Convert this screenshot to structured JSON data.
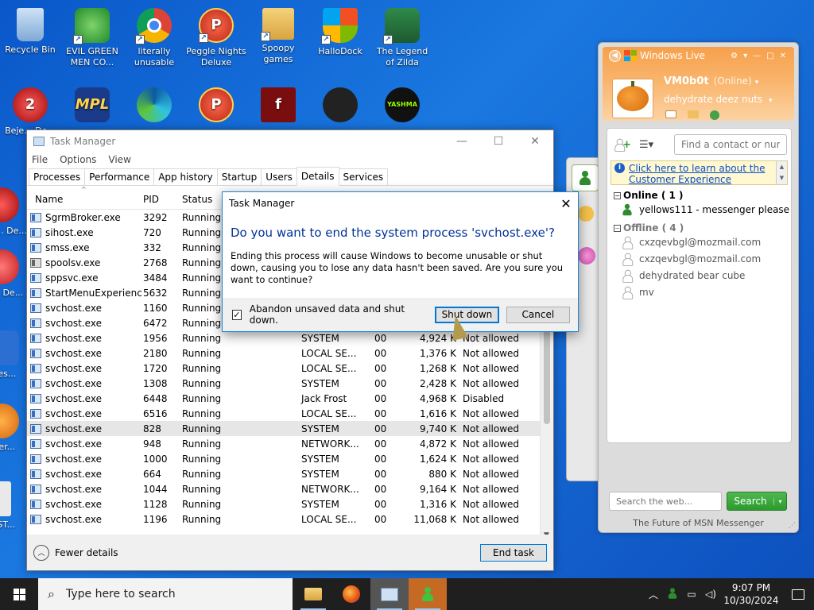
{
  "desktop": {
    "icons": [
      {
        "label": "Recycle Bin"
      },
      {
        "label": "EVIL GREEN MEN CO..."
      },
      {
        "label": "literally unusable"
      },
      {
        "label": "Peggle Nights Deluxe"
      },
      {
        "label": "Spoopy games"
      },
      {
        "label": "HalloDock"
      },
      {
        "label": "The Legend of Zilda"
      },
      {
        "label": "Beje... De..."
      },
      {
        "label": "Beje... De..."
      },
      {
        "label": "Ch... De..."
      },
      {
        "label": "does..."
      },
      {
        "label": "Ever..."
      },
      {
        "label": "INST..."
      }
    ]
  },
  "taskmgr": {
    "title": "Task Manager",
    "menu": [
      "File",
      "Options",
      "View"
    ],
    "tabs": [
      "Processes",
      "Performance",
      "App history",
      "Startup",
      "Users",
      "Details",
      "Services"
    ],
    "active_tab": "Details",
    "columns": {
      "name": "Name",
      "pid": "PID",
      "status": "Status"
    },
    "rows": [
      {
        "name": "SgrmBroker.exe",
        "pid": "3292",
        "status": "Running",
        "user": "",
        "cpu": "",
        "mem": "",
        "uac": ""
      },
      {
        "name": "sihost.exe",
        "pid": "720",
        "status": "Running",
        "user": "",
        "cpu": "",
        "mem": "",
        "uac": ""
      },
      {
        "name": "smss.exe",
        "pid": "332",
        "status": "Running",
        "user": "",
        "cpu": "",
        "mem": "",
        "uac": ""
      },
      {
        "name": "spoolsv.exe",
        "pid": "2768",
        "status": "Running",
        "user": "",
        "cpu": "",
        "mem": "",
        "uac": "",
        "icon": "printer"
      },
      {
        "name": "sppsvc.exe",
        "pid": "3484",
        "status": "Running",
        "user": "",
        "cpu": "",
        "mem": "",
        "uac": ""
      },
      {
        "name": "StartMenuExperienc...",
        "pid": "5632",
        "status": "Running",
        "user": "",
        "cpu": "",
        "mem": "",
        "uac": ""
      },
      {
        "name": "svchost.exe",
        "pid": "1160",
        "status": "Running",
        "user": "",
        "cpu": "",
        "mem": "",
        "uac": ""
      },
      {
        "name": "svchost.exe",
        "pid": "6472",
        "status": "Running",
        "user": "",
        "cpu": "",
        "mem": "",
        "uac": ""
      },
      {
        "name": "svchost.exe",
        "pid": "1956",
        "status": "Running",
        "user": "SYSTEM",
        "cpu": "00",
        "mem": "4,924 K",
        "uac": "Not allowed"
      },
      {
        "name": "svchost.exe",
        "pid": "2180",
        "status": "Running",
        "user": "LOCAL SE...",
        "cpu": "00",
        "mem": "1,376 K",
        "uac": "Not allowed"
      },
      {
        "name": "svchost.exe",
        "pid": "1720",
        "status": "Running",
        "user": "LOCAL SE...",
        "cpu": "00",
        "mem": "1,268 K",
        "uac": "Not allowed"
      },
      {
        "name": "svchost.exe",
        "pid": "1308",
        "status": "Running",
        "user": "SYSTEM",
        "cpu": "00",
        "mem": "2,428 K",
        "uac": "Not allowed"
      },
      {
        "name": "svchost.exe",
        "pid": "6448",
        "status": "Running",
        "user": "Jack Frost",
        "cpu": "00",
        "mem": "4,968 K",
        "uac": "Disabled"
      },
      {
        "name": "svchost.exe",
        "pid": "6516",
        "status": "Running",
        "user": "LOCAL SE...",
        "cpu": "00",
        "mem": "1,616 K",
        "uac": "Not allowed"
      },
      {
        "name": "svchost.exe",
        "pid": "828",
        "status": "Running",
        "user": "SYSTEM",
        "cpu": "00",
        "mem": "9,740 K",
        "uac": "Not allowed",
        "selected": true
      },
      {
        "name": "svchost.exe",
        "pid": "948",
        "status": "Running",
        "user": "NETWORK...",
        "cpu": "00",
        "mem": "4,872 K",
        "uac": "Not allowed"
      },
      {
        "name": "svchost.exe",
        "pid": "1000",
        "status": "Running",
        "user": "SYSTEM",
        "cpu": "00",
        "mem": "1,624 K",
        "uac": "Not allowed"
      },
      {
        "name": "svchost.exe",
        "pid": "664",
        "status": "Running",
        "user": "SYSTEM",
        "cpu": "00",
        "mem": "880 K",
        "uac": "Not allowed"
      },
      {
        "name": "svchost.exe",
        "pid": "1044",
        "status": "Running",
        "user": "NETWORK...",
        "cpu": "00",
        "mem": "9,164 K",
        "uac": "Not allowed"
      },
      {
        "name": "svchost.exe",
        "pid": "1128",
        "status": "Running",
        "user": "SYSTEM",
        "cpu": "00",
        "mem": "1,316 K",
        "uac": "Not allowed"
      },
      {
        "name": "svchost.exe",
        "pid": "1196",
        "status": "Running",
        "user": "LOCAL SE...",
        "cpu": "00",
        "mem": "11,068 K",
        "uac": "Not allowed"
      }
    ],
    "fewer_details": "Fewer details",
    "end_task": "End task"
  },
  "dialog": {
    "title": "Task Manager",
    "question": "Do you want to end the system process 'svchost.exe'?",
    "body": "Ending this process will cause Windows to become unusable or shut down, causing you to lose any data hasn't been saved. Are you sure you want to continue?",
    "checkbox_label": "Abandon unsaved data and shut down.",
    "checkbox_checked": true,
    "shutdown_label": "Shut down",
    "cancel_label": "Cancel"
  },
  "msn": {
    "brand": "Windows Live",
    "name": "VM0b0t",
    "status": "(Online)",
    "personal_message": "dehydrate deez nuts",
    "find_placeholder": "Find a contact or number",
    "banner_text": "Click here to learn about the Customer Experience",
    "online_group": "Online ( 1 )",
    "online_contacts": [
      "yellows111 - messenger please"
    ],
    "offline_group": "Offline ( 4 )",
    "offline_contacts": [
      "cxzqevbgl@mozmail.com",
      "cxzqevbgl@mozmail.com",
      "dehydrated bear cube",
      "mv"
    ],
    "web_search_placeholder": "Search the web...",
    "search_label": "Search",
    "tagline": "The Future of MSN Messenger"
  },
  "taskbar": {
    "search_placeholder": "Type here to search",
    "time": "9:07 PM",
    "date": "10/30/2024"
  },
  "colors": {
    "accent": "#0078d7",
    "question_blue": "#003399",
    "msn_orange": "#f7a04c",
    "msn_green": "#2c9a2c"
  }
}
